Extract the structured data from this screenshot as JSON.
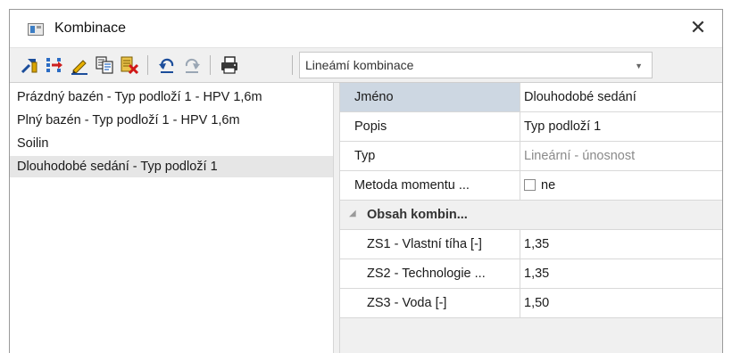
{
  "window": {
    "title": "Kombinace",
    "close_glyph": "✕"
  },
  "toolbar": {
    "buttons": [
      {
        "name": "new-combination-icon"
      },
      {
        "name": "insert-icon"
      },
      {
        "name": "edit-icon"
      },
      {
        "name": "copy-icon"
      },
      {
        "name": "delete-icon"
      },
      {
        "name": "undo-icon"
      },
      {
        "name": "redo-icon"
      },
      {
        "name": "print-icon"
      }
    ],
    "combo_value": "Lineámí kombinace",
    "combo_arrow": "▼"
  },
  "list": {
    "items": [
      "Prázdný bazén - Typ podloží 1 - HPV 1,6m",
      "Plný bazén - Typ podloží 1 - HPV 1,6m",
      "Soilin",
      "Dlouhodobé sedání - Typ podloží 1"
    ],
    "selected_index": 3
  },
  "properties": {
    "rows": [
      {
        "label": "Jméno",
        "value": "Dlouhodobé sedání"
      },
      {
        "label": "Popis",
        "value": "Typ podloží 1"
      },
      {
        "label": "Typ",
        "value": "Lineární - únosnost"
      },
      {
        "label": "Metoda momentu ...",
        "value": "ne"
      }
    ],
    "category": {
      "label": "Obsah kombin...",
      "chevron": "◢"
    },
    "sub_rows": [
      {
        "label": "ZS1 - Vlastní tíha [-]",
        "value": "1,35"
      },
      {
        "label": "ZS2 - Technologie ...",
        "value": "1,35"
      },
      {
        "label": "ZS3 - Voda [-]",
        "value": "1,50"
      }
    ]
  },
  "colors": {
    "selection_label": "#cdd7e2",
    "list_selected": "#e6e6e6",
    "toolbar_bg": "#f0f0f0"
  }
}
